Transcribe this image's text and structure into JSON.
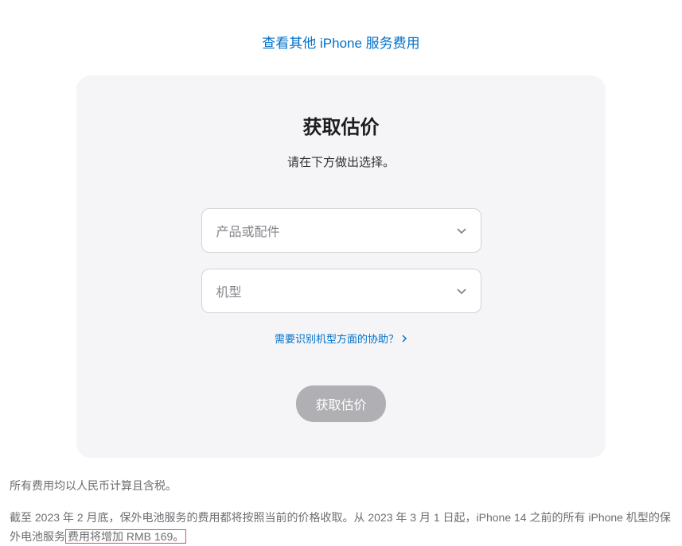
{
  "topLink": "查看其他 iPhone 服务费用",
  "card": {
    "title": "获取估价",
    "subtitle": "请在下方做出选择。",
    "select1": {
      "placeholder": "产品或配件"
    },
    "select2": {
      "placeholder": "机型"
    },
    "helpLink": "需要识别机型方面的协助？",
    "button": "获取估价"
  },
  "footer": {
    "line1": "所有费用均以人民币计算且含税。",
    "line2Part1": "截至 2023 年 2 月底，保外电池服务的费用都将按照当前的价格收取。从 2023 年 3 月 1 日起，iPhone 14 之前的所有 iPhone 机型的保外电池服务",
    "line2Part2": "费用将增加 RMB 169。"
  }
}
